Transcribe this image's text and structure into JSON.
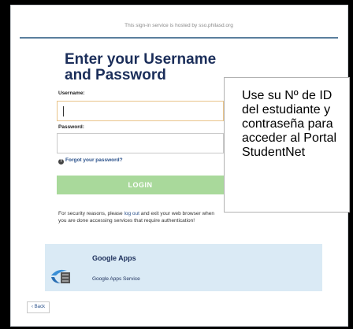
{
  "header": {
    "host_text": "This sign-in service is hosted by sso.philasd.org"
  },
  "form": {
    "title_line1": "Enter your Username",
    "title_line2": "and Password",
    "username_label": "Username:",
    "password_label": "Password:",
    "forgot_link": "Forgot your password?",
    "login_button": "LOGIN"
  },
  "security": {
    "text_before": "For security reasons, please ",
    "link": "log out",
    "text_after": " and exit your web browser when you are done accessing services that require authentication!"
  },
  "service": {
    "name": "Google Apps",
    "description": "Google Apps Service"
  },
  "nav": {
    "back_label": "Back"
  },
  "callout": {
    "text": "Use su Nº de ID del estudiante y contraseña para acceder al Portal StudentNet"
  },
  "colors": {
    "accent": "#5a7f9d",
    "title": "#1b2e5a",
    "login": "#a9d99b",
    "service_bg": "#daeaf5"
  }
}
